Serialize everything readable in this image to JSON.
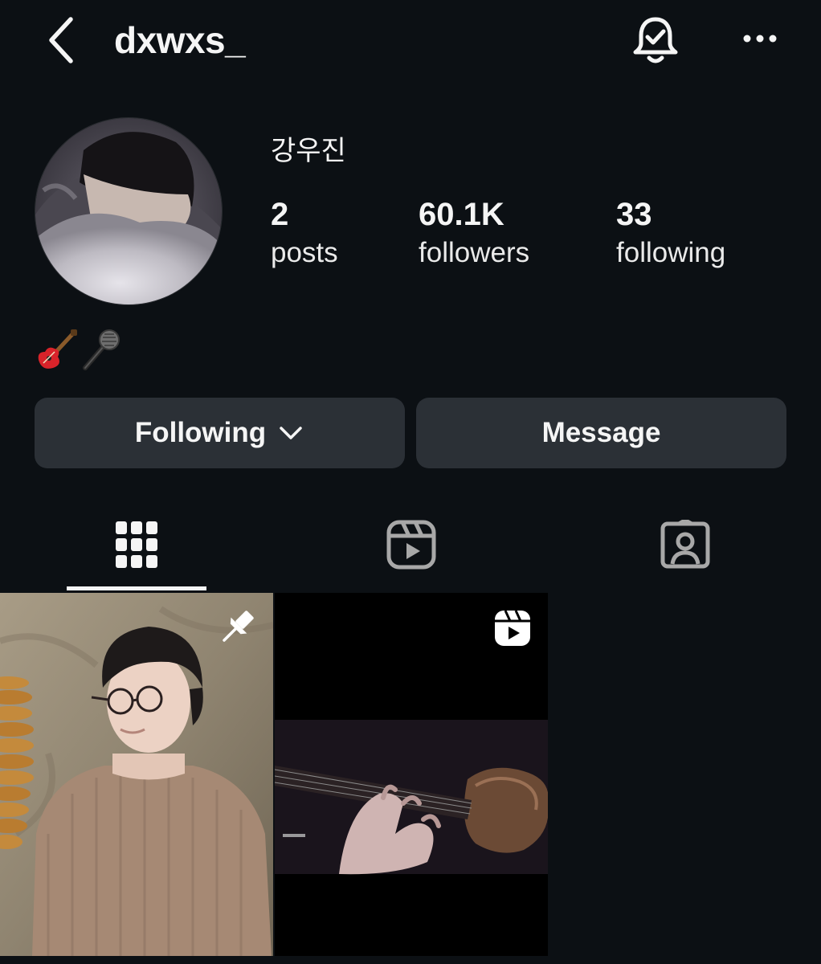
{
  "header": {
    "username": "dxwxs_",
    "back_icon": "chevron-left-icon",
    "notifications_icon": "bell-check-icon",
    "more_icon": "more-horizontal-icon"
  },
  "profile": {
    "full_name": "강우진",
    "stats": [
      {
        "value": "2",
        "label": "posts"
      },
      {
        "value": "60.1K",
        "label": "followers"
      },
      {
        "value": "33",
        "label": "following"
      }
    ],
    "bio_icons": [
      "guitar-emoji",
      "microphone-emoji"
    ]
  },
  "actions": {
    "following_label": "Following",
    "message_label": "Message"
  },
  "tabs": [
    {
      "icon": "grid-icon",
      "active": true
    },
    {
      "icon": "reels-icon",
      "active": false
    },
    {
      "icon": "tagged-icon",
      "active": false
    }
  ],
  "posts": [
    {
      "type": "photo",
      "badge": "pin-icon"
    },
    {
      "type": "reel",
      "badge": "reels-icon"
    }
  ],
  "colors": {
    "background": "#0c1014",
    "button": "#2b3036",
    "text": "#f5f5f5"
  }
}
